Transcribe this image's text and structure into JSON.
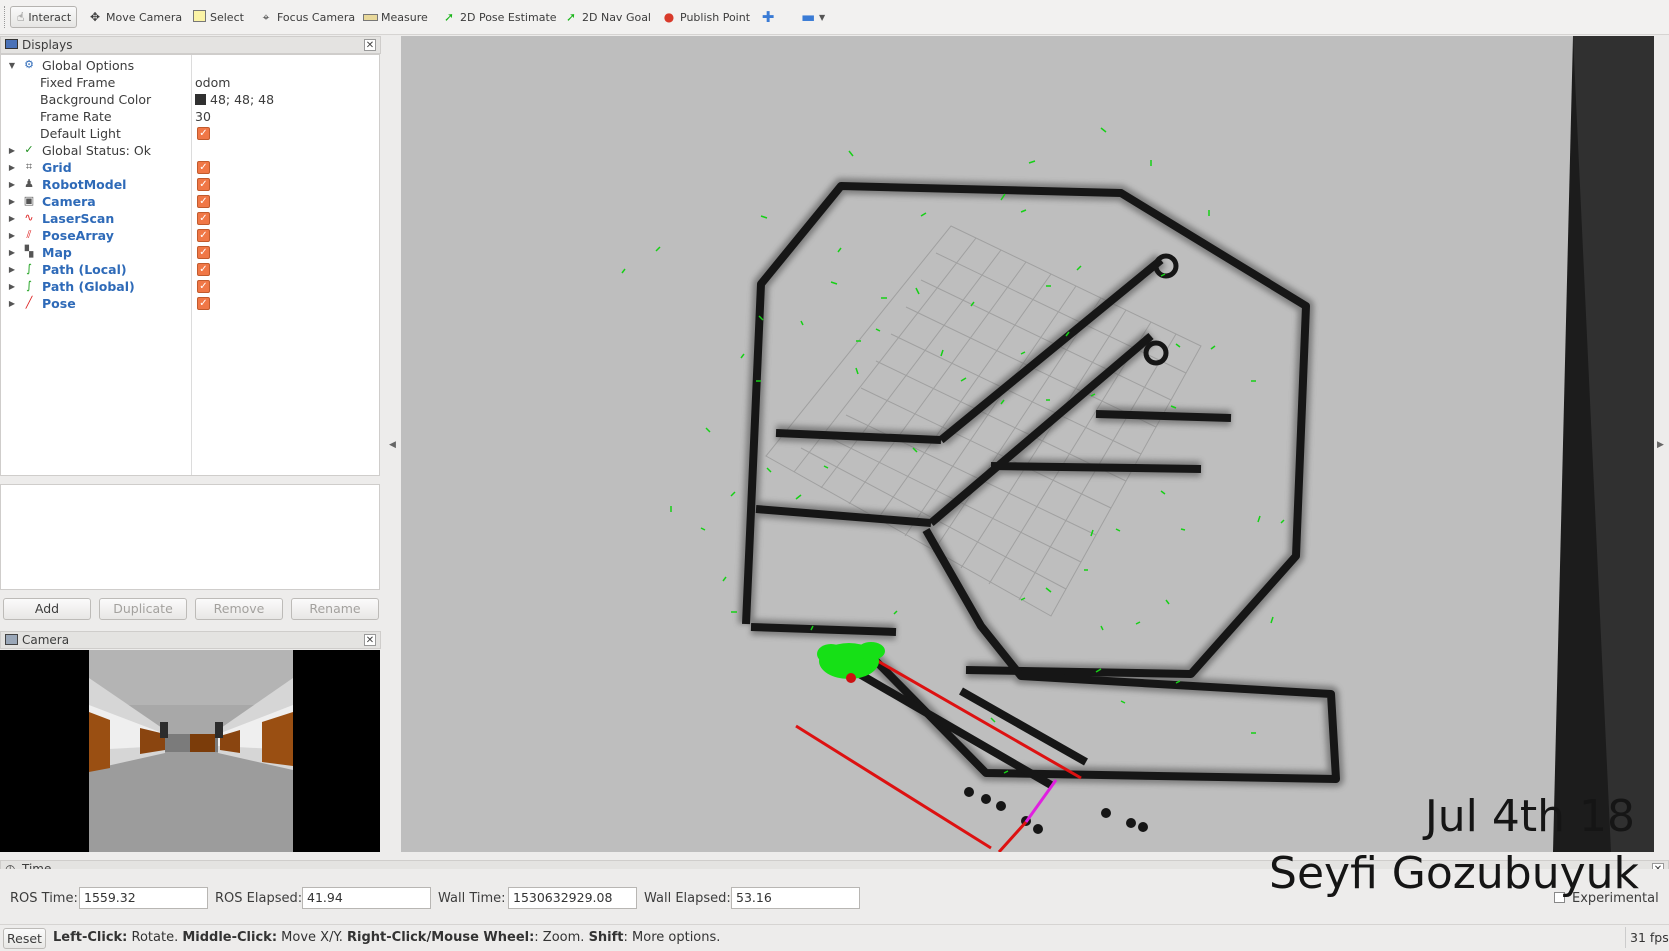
{
  "toolbar": {
    "tools": [
      {
        "label": "Interact",
        "icon": "hand-icon"
      },
      {
        "label": "Move Camera",
        "icon": "move-camera-icon"
      },
      {
        "label": "Select",
        "icon": "select-icon"
      },
      {
        "label": "Focus Camera",
        "icon": "focus-camera-icon"
      },
      {
        "label": "Measure",
        "icon": "measure-icon"
      },
      {
        "label": "2D Pose Estimate",
        "icon": "green-arrow-icon"
      },
      {
        "label": "2D Nav Goal",
        "icon": "green-arrow-icon"
      },
      {
        "label": "Publish Point",
        "icon": "map-pin-icon"
      }
    ],
    "active_tool": "Interact"
  },
  "displays_panel": {
    "title": "Displays",
    "global_options": {
      "label": "Global Options",
      "fixed_frame_label": "Fixed Frame",
      "fixed_frame_value": "odom",
      "background_color_label": "Background Color",
      "background_color_value": "48; 48; 48",
      "background_color_hex": "#303030",
      "frame_rate_label": "Frame Rate",
      "frame_rate_value": "30",
      "default_light_label": "Default Light"
    },
    "global_status": "Global Status: Ok",
    "displays": [
      {
        "label": "Grid",
        "icon": "grid-icon",
        "enabled": true
      },
      {
        "label": "RobotModel",
        "icon": "robot-model-icon",
        "enabled": true
      },
      {
        "label": "Camera",
        "icon": "camera-icon",
        "enabled": true
      },
      {
        "label": "LaserScan",
        "icon": "laser-scan-icon",
        "enabled": true
      },
      {
        "label": "PoseArray",
        "icon": "pose-array-icon",
        "enabled": true
      },
      {
        "label": "Map",
        "icon": "map-icon",
        "enabled": true
      },
      {
        "label": "Path (Local)",
        "icon": "path-icon",
        "enabled": true
      },
      {
        "label": "Path (Global)",
        "icon": "path-icon",
        "enabled": true
      },
      {
        "label": "Pose",
        "icon": "pose-icon",
        "enabled": true
      }
    ],
    "buttons": {
      "add": "Add",
      "duplicate": "Duplicate",
      "remove": "Remove",
      "rename": "Rename"
    }
  },
  "camera_panel": {
    "title": "Camera"
  },
  "viewport": {
    "watermark_date": "Jul 4th 18",
    "watermark_name": "Seyfi Gozubuyuk",
    "background_color": "#bebebe",
    "wall_color": "#1a1a1a",
    "particle_color": "#16e016",
    "laser_color": "#dd1111",
    "pose_color": "#e020e0"
  },
  "time_panel": {
    "title": "Time",
    "ros_time_label": "ROS Time:",
    "ros_time_value": "1559.32",
    "ros_elapsed_label": "ROS Elapsed:",
    "ros_elapsed_value": "41.94",
    "wall_time_label": "Wall Time:",
    "wall_time_value": "1530632929.08",
    "wall_elapsed_label": "Wall Elapsed:",
    "wall_elapsed_value": "53.16",
    "experimental_label": "Experimental"
  },
  "status_bar": {
    "reset_label": "Reset",
    "hint_left_click": "Left-Click:",
    "hint_left_action": " Rotate. ",
    "hint_middle_click": "Middle-Click:",
    "hint_middle_action": " Move X/Y. ",
    "hint_right_click": "Right-Click/Mouse Wheel:",
    "hint_right_action": ": Zoom. ",
    "hint_shift": "Shift",
    "hint_shift_action": ": More options.",
    "fps": "31 fps"
  }
}
